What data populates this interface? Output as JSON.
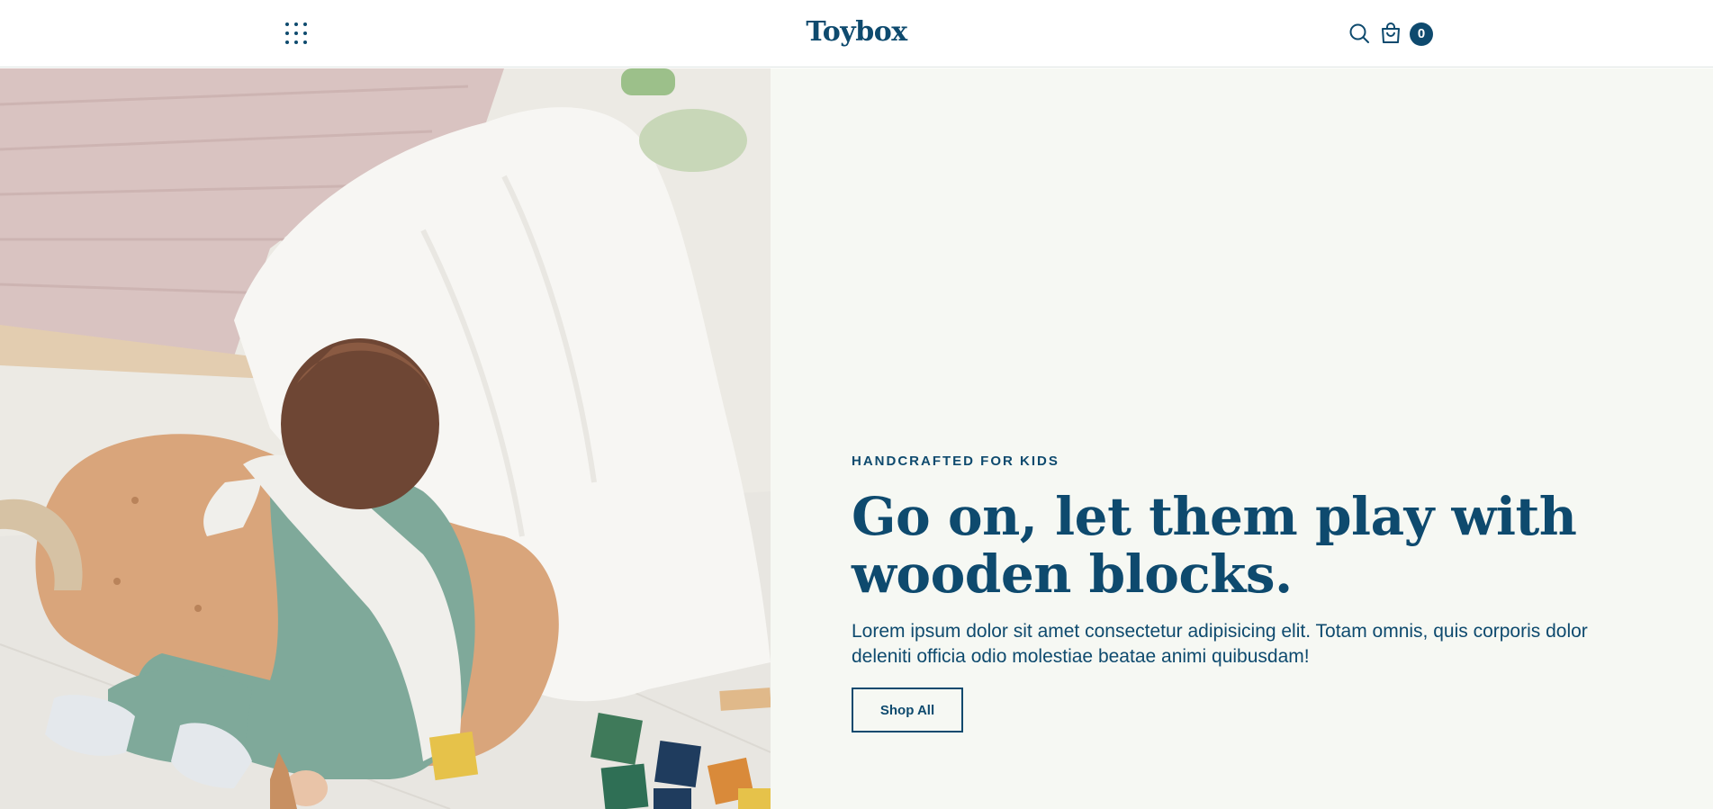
{
  "header": {
    "menu_icon": "grid-menu-icon",
    "logo": "Toybox",
    "search_icon": "search-icon",
    "cart_icon": "shopping-bag-icon",
    "cart_count": "0"
  },
  "hero": {
    "image_description": "child-playing-with-wooden-blocks",
    "eyebrow": "HANDCRAFTED FOR KIDS",
    "headline": "Go on, let them play with wooden blocks.",
    "body": "Lorem ipsum dolor sit amet consectetur adipisicing elit. Totam omnis, quis corporis dolor deleniti officia odio molestiae beatae animi quibusdam!",
    "cta_label": "Shop All"
  },
  "colors": {
    "brand": "#0e4a6e",
    "panel_background": "#f6f8f3",
    "header_background": "#ffffff"
  }
}
